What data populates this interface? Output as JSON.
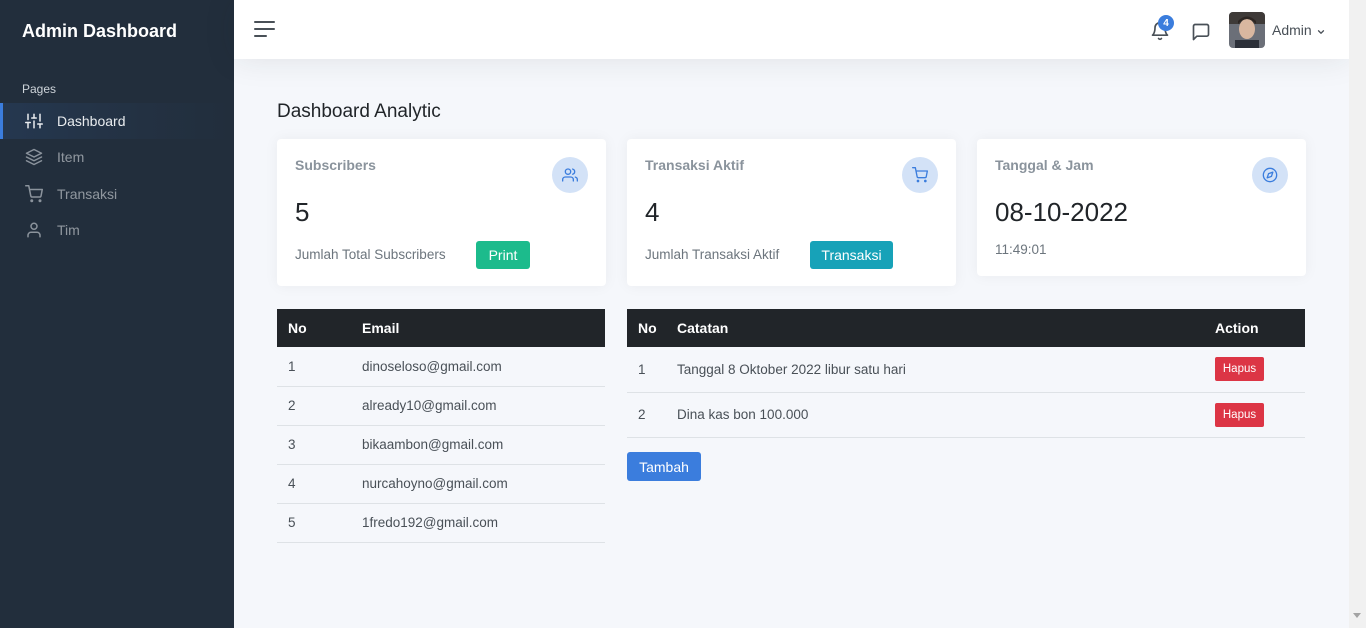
{
  "sidebar": {
    "brand": "Admin Dashboard",
    "section_header": "Pages",
    "items": [
      {
        "label": "Dashboard",
        "icon": "sliders-icon",
        "active": true
      },
      {
        "label": "Item",
        "icon": "layers-icon",
        "active": false
      },
      {
        "label": "Transaksi",
        "icon": "cart-icon",
        "active": false
      },
      {
        "label": "Tim",
        "icon": "user-icon",
        "active": false
      }
    ]
  },
  "topbar": {
    "notification_count": "4",
    "user_name": "Admin"
  },
  "main": {
    "page_title": "Dashboard Analytic",
    "cards": [
      {
        "title": "Subscribers",
        "value": "5",
        "subtitle": "Jumlah Total Subscribers",
        "button": "Print",
        "icon": "users-icon"
      },
      {
        "title": "Transaksi Aktif",
        "value": "4",
        "subtitle": "Jumlah Transaksi Aktif",
        "button": "Transaksi",
        "icon": "shopping-cart-icon"
      },
      {
        "title": "Tanggal & Jam",
        "value": "08-10-2022",
        "subtitle": "11:49:01",
        "icon": "compass-icon"
      }
    ],
    "subscribers_table": {
      "headers": [
        "No",
        "Email"
      ],
      "rows": [
        [
          "1",
          "dinoseloso@gmail.com"
        ],
        [
          "2",
          "already10@gmail.com"
        ],
        [
          "3",
          "bikaambon@gmail.com"
        ],
        [
          "4",
          "nurcahoyno@gmail.com"
        ],
        [
          "5",
          "1fredo192@gmail.com"
        ]
      ]
    },
    "notes_table": {
      "headers": [
        "No",
        "Catatan",
        "Action"
      ],
      "rows": [
        [
          "1",
          "Tanggal 8 Oktober 2022 libur satu hari",
          "Hapus"
        ],
        [
          "2",
          "Dina kas bon 100.000",
          "Hapus"
        ]
      ]
    },
    "add_button": "Tambah"
  },
  "colors": {
    "sidebar_bg": "#222e3c",
    "primary": "#3b7ddd",
    "success": "#1cbb8c",
    "info": "#17a2b8",
    "danger": "#dc3545",
    "table_header": "#212529"
  }
}
